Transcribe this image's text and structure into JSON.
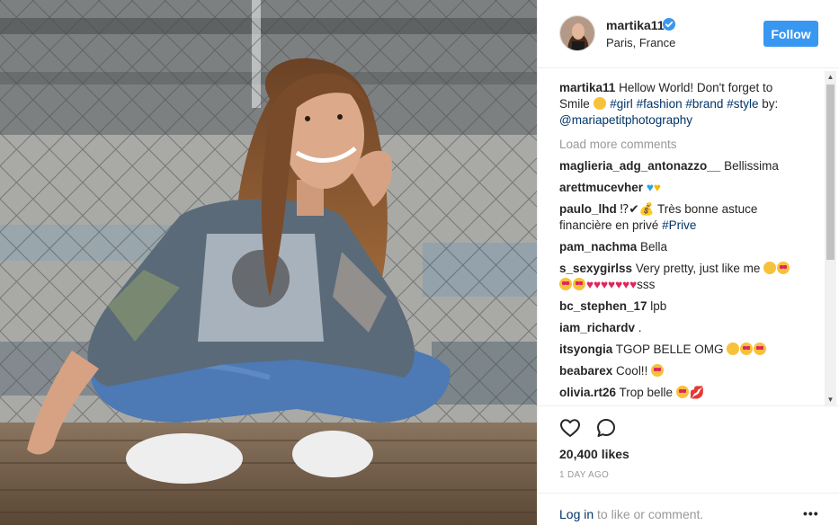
{
  "post": {
    "username": "martika11",
    "location": "Paris, France",
    "follow_label": "Follow",
    "verified_icon": "verified-badge-icon",
    "caption": {
      "user": "martika11",
      "text_1": " Hellow World! Don't forget to Smile ",
      "tags": [
        "#girl",
        "#fashion",
        "#brand",
        "#style"
      ],
      "by_text": " by:",
      "mention": "@mariapetitphotography"
    },
    "load_more": "Load more comments",
    "comments": [
      {
        "user": "maglieria_adg_antonazzo__",
        "text": " Bellissima"
      },
      {
        "user": "arettmucevher",
        "text": " "
      },
      {
        "user": "paulo_lhd",
        "text_1": " ⁉✔💰 Très bonne astuce financière en privé ",
        "tag": "#Prive"
      },
      {
        "user": "pam_nachma",
        "text": " Bella"
      },
      {
        "user": "s_sexygirlss",
        "text_1": " Very pretty, just like me",
        "text_2": "sss"
      },
      {
        "user": "bc_stephen_17",
        "text": " lpb"
      },
      {
        "user": "iam_richardv",
        "text": " ."
      },
      {
        "user": "itsyongia",
        "text": " TGOP BELLE OMG "
      },
      {
        "user": "beabarex",
        "text": " Cool!! "
      },
      {
        "user": "olivia.rt26",
        "text": " Trop belle "
      }
    ],
    "likes": "20,400 likes",
    "time": "1 DAY AGO",
    "login_link": "Log in",
    "login_rest": " to like or comment.",
    "more_options": "•••"
  },
  "colors": {
    "accent": "#3897f0",
    "link": "#003569",
    "muted": "#999999",
    "heart_red": "#e0245e"
  }
}
